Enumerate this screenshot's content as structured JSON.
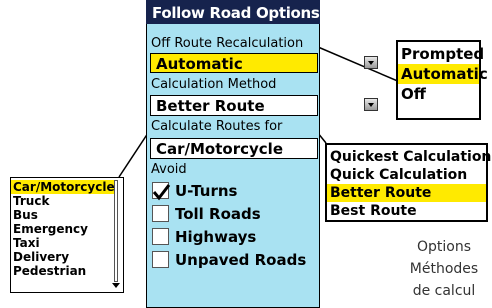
{
  "title": "Follow Road Options",
  "off_route": {
    "label": "Off Route Recalculation",
    "value": "Automatic"
  },
  "calc_method": {
    "label": "Calculation Method",
    "value": "Better Route"
  },
  "calc_for": {
    "label": "Calculate Routes for",
    "value": "Car/Motorcycle"
  },
  "avoid": {
    "label": "Avoid",
    "items": [
      {
        "label": "U-Turns",
        "checked": true
      },
      {
        "label": "Toll Roads",
        "checked": false
      },
      {
        "label": "Highways",
        "checked": false
      },
      {
        "label": "Unpaved Roads",
        "checked": false
      }
    ]
  },
  "recalc_options": [
    "Prompted",
    "Automatic",
    "Off"
  ],
  "recalc_selected": "Automatic",
  "method_options": [
    "Quickest Calculation",
    "Quick Calculation",
    "Better Route",
    "Best Route"
  ],
  "method_selected": "Better Route",
  "vehicle_options": [
    "Car/Motorcycle",
    "Truck",
    "Bus",
    "Emergency",
    "Taxi",
    "Delivery",
    "Pedestrian"
  ],
  "vehicle_selected": "Car/Motorcycle",
  "caption": {
    "line1": "Options",
    "line2": "Méthodes",
    "line3": "de calcul"
  },
  "colors": {
    "title_bg": "#16234d",
    "panel_bg": "#a9e2f2",
    "highlight": "#ffea00"
  }
}
